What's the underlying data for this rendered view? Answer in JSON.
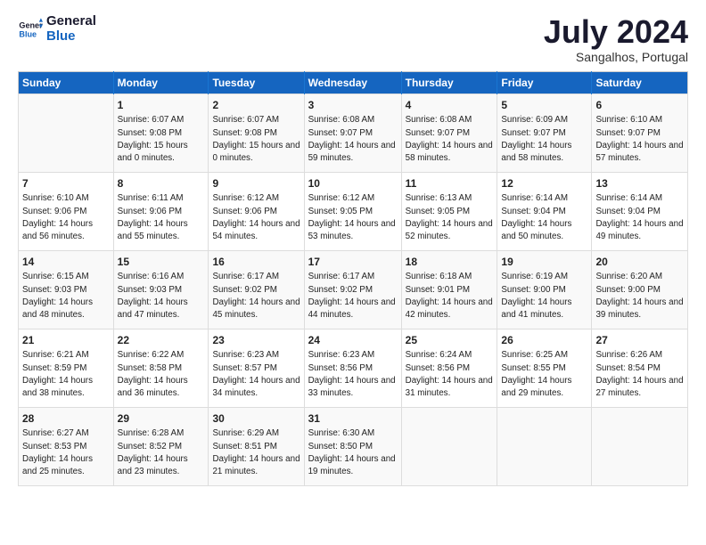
{
  "logo": {
    "line1": "General",
    "line2": "Blue"
  },
  "title": "July 2024",
  "subtitle": "Sangalhos, Portugal",
  "header_days": [
    "Sunday",
    "Monday",
    "Tuesday",
    "Wednesday",
    "Thursday",
    "Friday",
    "Saturday"
  ],
  "weeks": [
    [
      {
        "day": "",
        "sunrise": "",
        "sunset": "",
        "daylight": ""
      },
      {
        "day": "1",
        "sunrise": "Sunrise: 6:07 AM",
        "sunset": "Sunset: 9:08 PM",
        "daylight": "Daylight: 15 hours and 0 minutes."
      },
      {
        "day": "2",
        "sunrise": "Sunrise: 6:07 AM",
        "sunset": "Sunset: 9:08 PM",
        "daylight": "Daylight: 15 hours and 0 minutes."
      },
      {
        "day": "3",
        "sunrise": "Sunrise: 6:08 AM",
        "sunset": "Sunset: 9:07 PM",
        "daylight": "Daylight: 14 hours and 59 minutes."
      },
      {
        "day": "4",
        "sunrise": "Sunrise: 6:08 AM",
        "sunset": "Sunset: 9:07 PM",
        "daylight": "Daylight: 14 hours and 58 minutes."
      },
      {
        "day": "5",
        "sunrise": "Sunrise: 6:09 AM",
        "sunset": "Sunset: 9:07 PM",
        "daylight": "Daylight: 14 hours and 58 minutes."
      },
      {
        "day": "6",
        "sunrise": "Sunrise: 6:10 AM",
        "sunset": "Sunset: 9:07 PM",
        "daylight": "Daylight: 14 hours and 57 minutes."
      }
    ],
    [
      {
        "day": "7",
        "sunrise": "Sunrise: 6:10 AM",
        "sunset": "Sunset: 9:06 PM",
        "daylight": "Daylight: 14 hours and 56 minutes."
      },
      {
        "day": "8",
        "sunrise": "Sunrise: 6:11 AM",
        "sunset": "Sunset: 9:06 PM",
        "daylight": "Daylight: 14 hours and 55 minutes."
      },
      {
        "day": "9",
        "sunrise": "Sunrise: 6:12 AM",
        "sunset": "Sunset: 9:06 PM",
        "daylight": "Daylight: 14 hours and 54 minutes."
      },
      {
        "day": "10",
        "sunrise": "Sunrise: 6:12 AM",
        "sunset": "Sunset: 9:05 PM",
        "daylight": "Daylight: 14 hours and 53 minutes."
      },
      {
        "day": "11",
        "sunrise": "Sunrise: 6:13 AM",
        "sunset": "Sunset: 9:05 PM",
        "daylight": "Daylight: 14 hours and 52 minutes."
      },
      {
        "day": "12",
        "sunrise": "Sunrise: 6:14 AM",
        "sunset": "Sunset: 9:04 PM",
        "daylight": "Daylight: 14 hours and 50 minutes."
      },
      {
        "day": "13",
        "sunrise": "Sunrise: 6:14 AM",
        "sunset": "Sunset: 9:04 PM",
        "daylight": "Daylight: 14 hours and 49 minutes."
      }
    ],
    [
      {
        "day": "14",
        "sunrise": "Sunrise: 6:15 AM",
        "sunset": "Sunset: 9:03 PM",
        "daylight": "Daylight: 14 hours and 48 minutes."
      },
      {
        "day": "15",
        "sunrise": "Sunrise: 6:16 AM",
        "sunset": "Sunset: 9:03 PM",
        "daylight": "Daylight: 14 hours and 47 minutes."
      },
      {
        "day": "16",
        "sunrise": "Sunrise: 6:17 AM",
        "sunset": "Sunset: 9:02 PM",
        "daylight": "Daylight: 14 hours and 45 minutes."
      },
      {
        "day": "17",
        "sunrise": "Sunrise: 6:17 AM",
        "sunset": "Sunset: 9:02 PM",
        "daylight": "Daylight: 14 hours and 44 minutes."
      },
      {
        "day": "18",
        "sunrise": "Sunrise: 6:18 AM",
        "sunset": "Sunset: 9:01 PM",
        "daylight": "Daylight: 14 hours and 42 minutes."
      },
      {
        "day": "19",
        "sunrise": "Sunrise: 6:19 AM",
        "sunset": "Sunset: 9:00 PM",
        "daylight": "Daylight: 14 hours and 41 minutes."
      },
      {
        "day": "20",
        "sunrise": "Sunrise: 6:20 AM",
        "sunset": "Sunset: 9:00 PM",
        "daylight": "Daylight: 14 hours and 39 minutes."
      }
    ],
    [
      {
        "day": "21",
        "sunrise": "Sunrise: 6:21 AM",
        "sunset": "Sunset: 8:59 PM",
        "daylight": "Daylight: 14 hours and 38 minutes."
      },
      {
        "day": "22",
        "sunrise": "Sunrise: 6:22 AM",
        "sunset": "Sunset: 8:58 PM",
        "daylight": "Daylight: 14 hours and 36 minutes."
      },
      {
        "day": "23",
        "sunrise": "Sunrise: 6:23 AM",
        "sunset": "Sunset: 8:57 PM",
        "daylight": "Daylight: 14 hours and 34 minutes."
      },
      {
        "day": "24",
        "sunrise": "Sunrise: 6:23 AM",
        "sunset": "Sunset: 8:56 PM",
        "daylight": "Daylight: 14 hours and 33 minutes."
      },
      {
        "day": "25",
        "sunrise": "Sunrise: 6:24 AM",
        "sunset": "Sunset: 8:56 PM",
        "daylight": "Daylight: 14 hours and 31 minutes."
      },
      {
        "day": "26",
        "sunrise": "Sunrise: 6:25 AM",
        "sunset": "Sunset: 8:55 PM",
        "daylight": "Daylight: 14 hours and 29 minutes."
      },
      {
        "day": "27",
        "sunrise": "Sunrise: 6:26 AM",
        "sunset": "Sunset: 8:54 PM",
        "daylight": "Daylight: 14 hours and 27 minutes."
      }
    ],
    [
      {
        "day": "28",
        "sunrise": "Sunrise: 6:27 AM",
        "sunset": "Sunset: 8:53 PM",
        "daylight": "Daylight: 14 hours and 25 minutes."
      },
      {
        "day": "29",
        "sunrise": "Sunrise: 6:28 AM",
        "sunset": "Sunset: 8:52 PM",
        "daylight": "Daylight: 14 hours and 23 minutes."
      },
      {
        "day": "30",
        "sunrise": "Sunrise: 6:29 AM",
        "sunset": "Sunset: 8:51 PM",
        "daylight": "Daylight: 14 hours and 21 minutes."
      },
      {
        "day": "31",
        "sunrise": "Sunrise: 6:30 AM",
        "sunset": "Sunset: 8:50 PM",
        "daylight": "Daylight: 14 hours and 19 minutes."
      },
      {
        "day": "",
        "sunrise": "",
        "sunset": "",
        "daylight": ""
      },
      {
        "day": "",
        "sunrise": "",
        "sunset": "",
        "daylight": ""
      },
      {
        "day": "",
        "sunrise": "",
        "sunset": "",
        "daylight": ""
      }
    ]
  ]
}
